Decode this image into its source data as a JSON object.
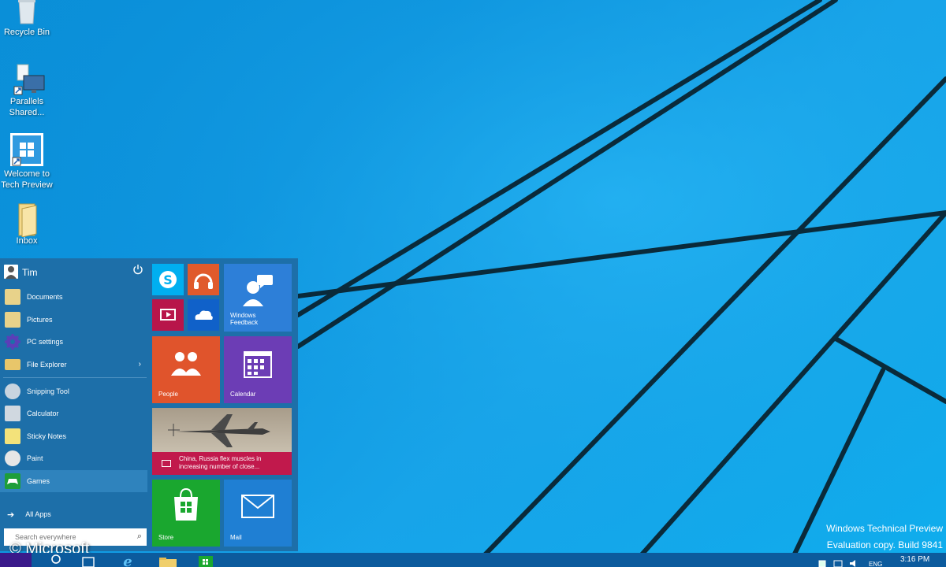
{
  "desktop": {
    "icons": [
      {
        "name": "recycle-bin",
        "label": "Recycle Bin"
      },
      {
        "name": "parallels-shared",
        "label": "Parallels Shared..."
      },
      {
        "name": "welcome-tech-preview",
        "label": "Welcome to Tech Preview"
      },
      {
        "name": "inbox",
        "label": "Inbox"
      }
    ]
  },
  "start_menu": {
    "user": "Tim",
    "places": [
      {
        "label": "Documents",
        "icon": "documents-icon"
      },
      {
        "label": "Pictures",
        "icon": "pictures-icon"
      },
      {
        "label": "PC settings",
        "icon": "gear-icon"
      },
      {
        "label": "File Explorer",
        "icon": "file-explorer-icon"
      }
    ],
    "apps": [
      {
        "label": "Snipping Tool",
        "icon": "snipping-tool-icon"
      },
      {
        "label": "Calculator",
        "icon": "calculator-icon"
      },
      {
        "label": "Sticky Notes",
        "icon": "sticky-notes-icon"
      },
      {
        "label": "Paint",
        "icon": "paint-icon"
      },
      {
        "label": "Games",
        "icon": "games-icon"
      }
    ],
    "all_apps": "All Apps",
    "search_placeholder": "Search everywhere",
    "tiles": {
      "feedback": "Windows Feedback",
      "people": "People",
      "calendar": "Calendar",
      "news": "China, Russia flex muscles in increasing number of close...",
      "store": "Store",
      "mail": "Mail"
    }
  },
  "watermark": {
    "line1": "Windows Technical Preview",
    "line2": "Evaluation copy. Build 9841",
    "copyright": "© Microsoft"
  },
  "taskbar": {
    "language": "ENG",
    "time": "3:16 PM"
  },
  "colors": {
    "start_bg": "#1d6fa9",
    "tile_skype": "#00aff0",
    "tile_music": "#e05a2b",
    "tile_video": "#b8154a",
    "tile_onedrive": "#1061c9",
    "tile_feedback": "#2d7fd8",
    "tile_people": "#e0542c",
    "tile_calendar": "#6c3db5",
    "tile_news": "#c1194c",
    "tile_store": "#1aa72f",
    "tile_mail": "#1f7fd3"
  }
}
